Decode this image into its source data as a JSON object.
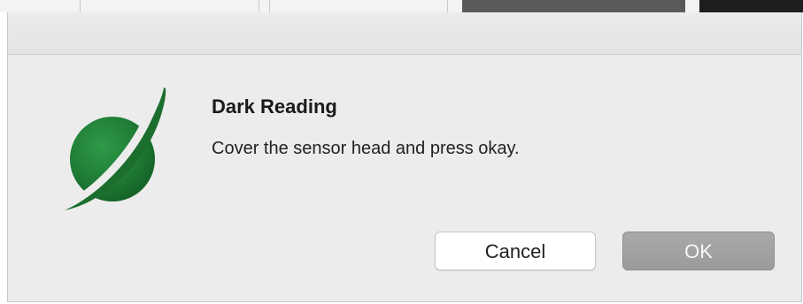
{
  "dialog": {
    "title": "Dark Reading",
    "message": "Cover the sensor head and press okay.",
    "icon": "planet-ring-logo-icon",
    "icon_colors": {
      "planet": "#1e7a34",
      "ring": "#1b6e2e"
    },
    "buttons": {
      "cancel_label": "Cancel",
      "ok_label": "OK"
    }
  }
}
